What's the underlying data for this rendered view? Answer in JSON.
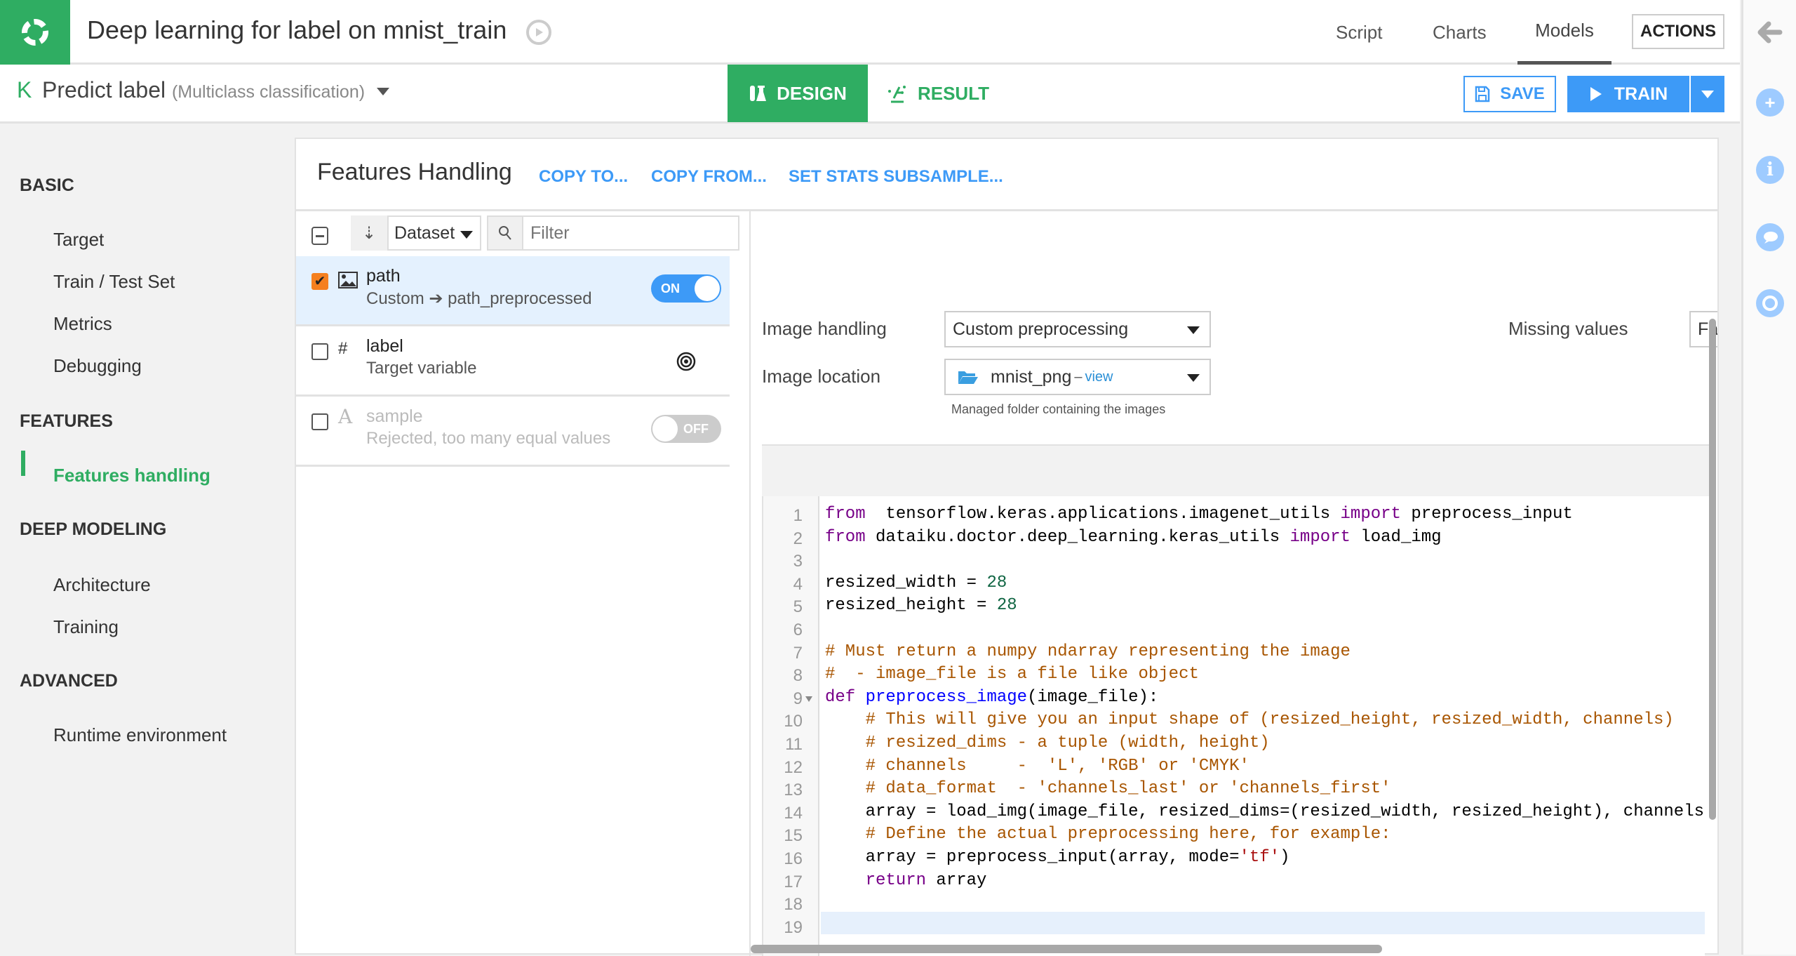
{
  "header": {
    "title": "Deep learning for label on mnist_train",
    "nav": [
      {
        "label": "Script"
      },
      {
        "label": "Charts"
      },
      {
        "label": "Models",
        "active": true
      }
    ],
    "actions_label": "ACTIONS"
  },
  "subheader": {
    "icon_letter": "K",
    "predict_label": "Predict label",
    "task_type": "(Multiclass classification)",
    "tabs": [
      {
        "label": "DESIGN",
        "active": true
      },
      {
        "label": "RESULT"
      }
    ],
    "save_label": "SAVE",
    "train_label": "TRAIN"
  },
  "rail": {
    "icons": [
      "back-arrow-icon",
      "plus-icon",
      "info-icon",
      "comment-icon",
      "clock-icon"
    ]
  },
  "sidebar": {
    "sections": [
      {
        "title": "BASIC",
        "items": [
          "Target",
          "Train / Test Set",
          "Metrics",
          "Debugging"
        ]
      },
      {
        "title": "FEATURES",
        "items": [
          "Features handling"
        ]
      },
      {
        "title": "DEEP MODELING",
        "items": [
          "Architecture",
          "Training"
        ]
      },
      {
        "title": "ADVANCED",
        "items": [
          "Runtime environment"
        ]
      }
    ],
    "active_item": "Features handling"
  },
  "panel": {
    "title": "Features Handling",
    "links": [
      "COPY TO...",
      "COPY FROM...",
      "SET STATS SUBSAMPLE..."
    ],
    "toolbar": {
      "sort_select": "Dataset",
      "filter_placeholder": "Filter"
    },
    "features": [
      {
        "name": "path",
        "type_icon": "image-icon",
        "desc_prefix": "Custom",
        "desc_target": "path_preprocessed",
        "checked": true,
        "toggle": "ON",
        "selected": true
      },
      {
        "name": "label",
        "type_icon": "#",
        "desc": "Target variable",
        "checked": false,
        "role_icon": "target-icon"
      },
      {
        "name": "sample",
        "type_icon": "A",
        "desc": "Rejected, too many equal values",
        "checked": false,
        "toggle": "OFF",
        "rejected": true
      }
    ],
    "detail": {
      "image_handling_label": "Image handling",
      "image_handling_value": "Custom preprocessing",
      "image_location_label": "Image location",
      "image_location_value": "mnist_png",
      "image_location_view": "view",
      "image_location_sep": "–",
      "image_location_hint": "Managed folder containing the images",
      "missing_values_label": "Missing values",
      "missing_values_value": "Fa"
    },
    "code": {
      "line_numbers": [
        "1",
        "2",
        "3",
        "4",
        "5",
        "6",
        "7",
        "8",
        "9",
        "10",
        "11",
        "12",
        "13",
        "14",
        "15",
        "16",
        "17",
        "18",
        "19"
      ],
      "active_line": 19,
      "lines": [
        [
          [
            "kw",
            "from"
          ],
          [
            "",
            "  tensorflow.keras.applications.imagenet_utils "
          ],
          [
            "kw",
            "import"
          ],
          [
            "",
            " preprocess_input"
          ]
        ],
        [
          [
            "kw",
            "from"
          ],
          [
            "",
            " dataiku.doctor.deep_learning.keras_utils "
          ],
          [
            "kw",
            "import"
          ],
          [
            "",
            " load_img"
          ]
        ],
        [],
        [
          [
            "",
            "resized_width = "
          ],
          [
            "num",
            "28"
          ]
        ],
        [
          [
            "",
            "resized_height = "
          ],
          [
            "num",
            "28"
          ]
        ],
        [],
        [
          [
            "cm",
            "# Must return a numpy ndarray representing the image"
          ]
        ],
        [
          [
            "cm",
            "#  - image_file is a file like object"
          ]
        ],
        [
          [
            "kw",
            "def"
          ],
          [
            "",
            " "
          ],
          [
            "def",
            "preprocess_image"
          ],
          [
            "",
            "(image_file):"
          ]
        ],
        [
          [
            "",
            "    "
          ],
          [
            "cm",
            "# This will give you an input shape of (resized_height, resized_width, channels)"
          ]
        ],
        [
          [
            "",
            "    "
          ],
          [
            "cm",
            "# resized_dims - a tuple (width, height)"
          ]
        ],
        [
          [
            "",
            "    "
          ],
          [
            "cm",
            "# channels     -  'L', 'RGB' or 'CMYK'"
          ]
        ],
        [
          [
            "",
            "    "
          ],
          [
            "cm",
            "# data_format  - 'channels_last' or 'channels_first'"
          ]
        ],
        [
          [
            "",
            "    array = load_img(image_file, resized_dims=(resized_width, resized_height), channels='L')"
          ]
        ],
        [
          [
            "",
            "    "
          ],
          [
            "cm",
            "# Define the actual preprocessing here, for example:"
          ]
        ],
        [
          [
            "",
            "    array = preprocess_input(array, mode="
          ],
          [
            "str",
            "'tf'"
          ],
          [
            "",
            ")"
          ]
        ],
        [
          [
            "",
            "    "
          ],
          [
            "kw",
            "return"
          ],
          [
            "",
            " array"
          ]
        ],
        [],
        []
      ]
    }
  },
  "colors": {
    "brand_green": "#2fad62",
    "accent_blue": "#3d9af7",
    "checkbox_orange": "#f5801f"
  }
}
